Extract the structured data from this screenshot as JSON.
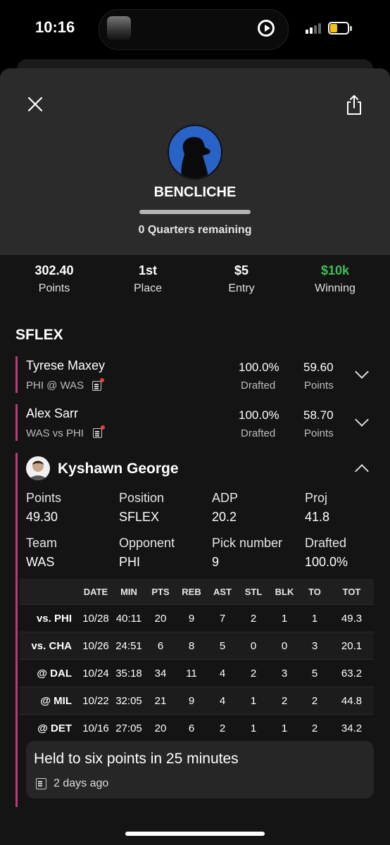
{
  "status": {
    "time": "10:16"
  },
  "header": {
    "username": "BENCLICHE",
    "remaining": "0 Quarters remaining",
    "progress": 0
  },
  "stats": [
    {
      "value": "302.40",
      "label": "Points",
      "color": "#ffffff"
    },
    {
      "value": "1st",
      "label": "Place",
      "color": "#ffffff"
    },
    {
      "value": "$5",
      "label": "Entry",
      "color": "#ffffff"
    },
    {
      "value": "$10k",
      "label": "Winning",
      "color": "#3fbf56"
    }
  ],
  "section": "SFLEX",
  "players": [
    {
      "name": "Tyrese Maxey",
      "matchup": "PHI @ WAS",
      "drafted": "100.0%",
      "drafted_label": "Drafted",
      "points": "59.60",
      "points_label": "Points"
    },
    {
      "name": "Alex Sarr",
      "matchup": "WAS vs PHI",
      "drafted": "100.0%",
      "drafted_label": "Drafted",
      "points": "58.70",
      "points_label": "Points"
    }
  ],
  "expanded": {
    "name": "Kyshawn George",
    "info": [
      {
        "k": "Points",
        "v": "49.30"
      },
      {
        "k": "Position",
        "v": "SFLEX"
      },
      {
        "k": "ADP",
        "v": "20.2"
      },
      {
        "k": "Proj",
        "v": "41.8"
      },
      {
        "k": "Team",
        "v": "WAS"
      },
      {
        "k": "Opponent",
        "v": "PHI"
      },
      {
        "k": "Pick number",
        "v": "9"
      },
      {
        "k": "Drafted",
        "v": "100.0%"
      }
    ],
    "table": {
      "headers": [
        "",
        "DATE",
        "MIN",
        "PTS",
        "REB",
        "AST",
        "STL",
        "BLK",
        "TO",
        "TOT"
      ],
      "rows": [
        [
          "vs. PHI",
          "10/28",
          "40:11",
          "20",
          "9",
          "7",
          "2",
          "1",
          "1",
          "49.3"
        ],
        [
          "vs. CHA",
          "10/26",
          "24:51",
          "6",
          "8",
          "5",
          "0",
          "0",
          "3",
          "20.1"
        ],
        [
          "@ DAL",
          "10/24",
          "35:18",
          "34",
          "11",
          "4",
          "2",
          "3",
          "5",
          "63.2"
        ],
        [
          "@ MIL",
          "10/22",
          "32:05",
          "21",
          "9",
          "4",
          "1",
          "2",
          "2",
          "44.8"
        ],
        [
          "@ DET",
          "10/16",
          "27:05",
          "20",
          "6",
          "2",
          "1",
          "1",
          "2",
          "34.2"
        ]
      ]
    },
    "news": {
      "headline": "Held to six points in 25 minutes",
      "time": "2 days ago"
    }
  }
}
